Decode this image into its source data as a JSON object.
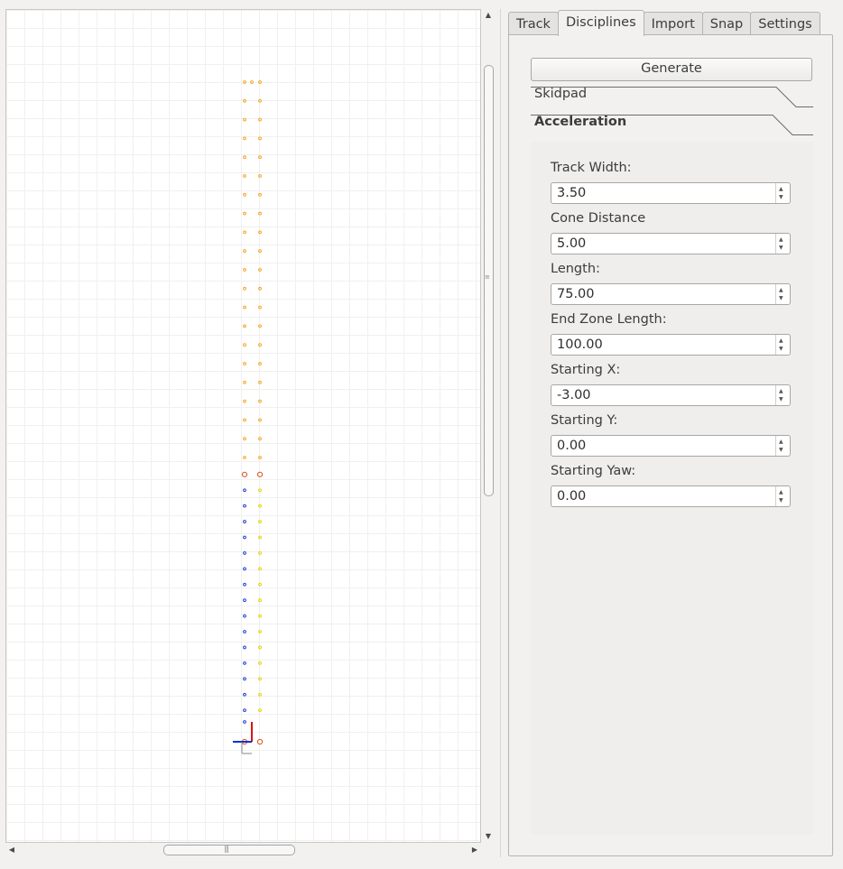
{
  "tabs": [
    {
      "label": "Track"
    },
    {
      "label": "Disciplines"
    },
    {
      "label": "Import"
    },
    {
      "label": "Snap"
    },
    {
      "label": "Settings"
    }
  ],
  "active_tab": "Disciplines",
  "generate_label": "Generate",
  "sections": {
    "skidpad": "Skidpad",
    "acceleration": "Acceleration"
  },
  "fields": [
    {
      "label": "Track Width:",
      "value": "3.50"
    },
    {
      "label": "Cone Distance",
      "value": "5.00"
    },
    {
      "label": "Length:",
      "value": "75.00"
    },
    {
      "label": "End Zone Length:",
      "value": "100.00"
    },
    {
      "label": "Starting X:",
      "value": "-3.00"
    },
    {
      "label": "Starting Y:",
      "value": "0.00"
    },
    {
      "label": "Starting Yaw:",
      "value": "0.00"
    }
  ],
  "colors": {
    "cone_orange": "#f5a623",
    "cone_blue": "#2a3fd6",
    "cone_yellow": "#e8d200",
    "cone_big_orange": "#d9531e",
    "axis_x": "#e01010",
    "axis_y": "#1030d0"
  },
  "track_preview": {
    "cone_pairs_per_side": 16,
    "end_zone_orange_pairs": 21,
    "timing_cone_pairs": 2
  }
}
